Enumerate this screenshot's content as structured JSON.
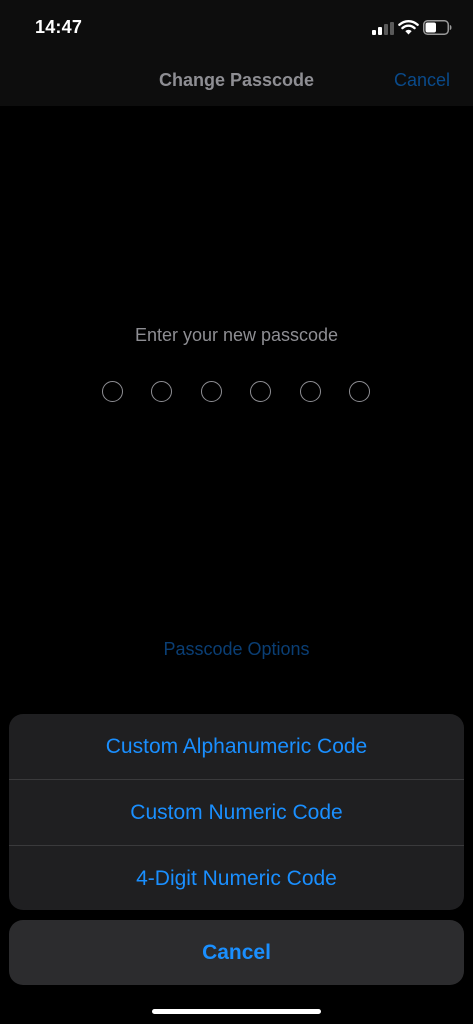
{
  "status_bar": {
    "time": "14:47",
    "signal_icon": "cellular-signal-icon",
    "wifi_icon": "wifi-icon",
    "battery_icon": "battery-icon",
    "battery_level": 0.5
  },
  "nav": {
    "title": "Change Passcode",
    "cancel_label": "Cancel"
  },
  "passcode": {
    "prompt": "Enter your new passcode",
    "digit_count": 6,
    "entered_count": 0
  },
  "options_link": "Passcode Options",
  "action_sheet": {
    "items": [
      {
        "label": "Custom Alphanumeric Code"
      },
      {
        "label": "Custom Numeric Code"
      },
      {
        "label": "4-Digit Numeric Code"
      }
    ],
    "cancel_label": "Cancel"
  },
  "colors": {
    "accent": "#1a8fff",
    "background": "#000000",
    "sheet_background": "#1f1f21",
    "muted_text": "#8e8e93"
  }
}
